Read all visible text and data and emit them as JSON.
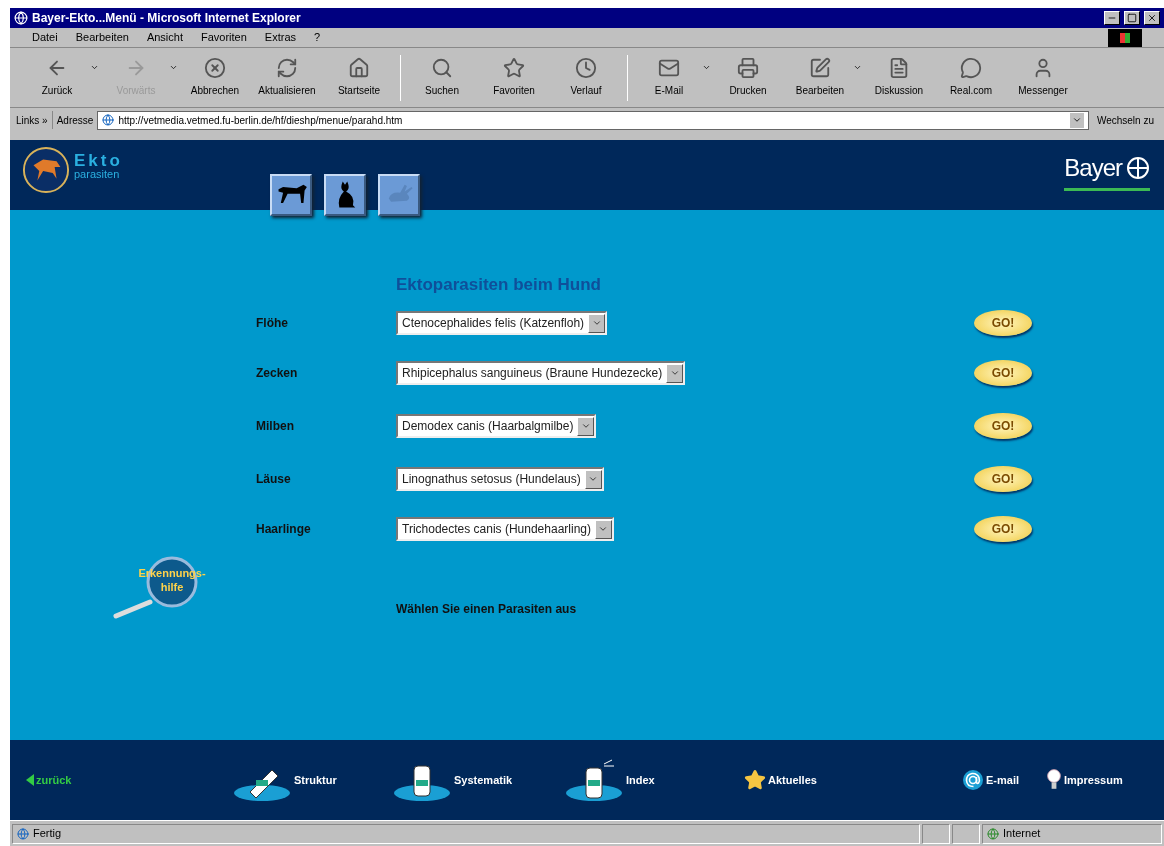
{
  "window": {
    "title": "Bayer-Ekto...Menü - Microsoft Internet Explorer"
  },
  "menu": [
    "Datei",
    "Bearbeiten",
    "Ansicht",
    "Favoriten",
    "Extras",
    "?"
  ],
  "toolbar": [
    {
      "kind": "back",
      "label": "Zurück",
      "disabled": false,
      "has_menu": true
    },
    {
      "kind": "forward",
      "label": "Vorwärts",
      "disabled": true,
      "has_menu": true
    },
    {
      "kind": "stop",
      "label": "Abbrechen",
      "disabled": false,
      "has_menu": false
    },
    {
      "kind": "refresh",
      "label": "Aktualisieren",
      "disabled": false,
      "has_menu": false
    },
    {
      "kind": "home",
      "label": "Startseite",
      "disabled": false,
      "has_menu": false
    },
    {
      "kind": "search",
      "label": "Suchen",
      "disabled": false,
      "has_menu": false
    },
    {
      "kind": "favorites",
      "label": "Favoriten",
      "disabled": false,
      "has_menu": false
    },
    {
      "kind": "history",
      "label": "Verlauf",
      "disabled": false,
      "has_menu": false
    },
    {
      "kind": "mail",
      "label": "E-Mail",
      "disabled": false,
      "has_menu": true
    },
    {
      "kind": "print",
      "label": "Drucken",
      "disabled": false,
      "has_menu": false
    },
    {
      "kind": "edit",
      "label": "Bearbeiten",
      "disabled": false,
      "has_menu": true
    },
    {
      "kind": "discuss",
      "label": "Diskussion",
      "disabled": false,
      "has_menu": false
    },
    {
      "kind": "real",
      "label": "Real.com",
      "disabled": false,
      "has_menu": false
    },
    {
      "kind": "messenger",
      "label": "Messenger",
      "disabled": false,
      "has_menu": false
    }
  ],
  "address": {
    "links": "Links »",
    "label": "Adresse",
    "url": "http://vetmedia.vetmed.fu-berlin.de/hf/dieshp/menue/parahd.htm",
    "go": "Wechseln zu"
  },
  "page": {
    "logo": {
      "title": "Ekto",
      "subtitle": "parasiten"
    },
    "brand": "Bayer",
    "animals": [
      {
        "kind": "dog",
        "disabled": false
      },
      {
        "kind": "cat",
        "disabled": false
      },
      {
        "kind": "rabbit",
        "disabled": true
      }
    ],
    "heading": "Ektoparasiten beim Hund",
    "rows": [
      {
        "label": "Flöhe",
        "value": "Ctenocephalides felis (Katzenfloh)",
        "button": "GO!"
      },
      {
        "label": "Zecken",
        "value": "Rhipicephalus sanguineus (Braune Hundezecke)",
        "button": "GO!"
      },
      {
        "label": "Milben",
        "value": "Demodex canis (Haarbalgmilbe)",
        "button": "GO!"
      },
      {
        "label": "Läuse",
        "value": "Linognathus setosus (Hundelaus)",
        "button": "GO!"
      },
      {
        "label": "Haarlinge",
        "value": "Trichodectes canis (Hundehaarling)",
        "button": "GO!"
      }
    ],
    "hint": "Wählen Sie einen Parasiten aus",
    "helper": [
      "Erkennungs-",
      "hilfe"
    ]
  },
  "footer": {
    "back": "zurück",
    "items": [
      {
        "kind": "tube",
        "label": "Struktur"
      },
      {
        "kind": "bottle",
        "label": "Systematik"
      },
      {
        "kind": "spray",
        "label": "Index"
      },
      {
        "kind": "star",
        "label": "Aktuelles"
      },
      {
        "kind": "at",
        "label": "E-mail"
      },
      {
        "kind": "bulb",
        "label": "Impressum"
      }
    ]
  },
  "status": {
    "text": "Fertig",
    "zone": "Internet"
  }
}
